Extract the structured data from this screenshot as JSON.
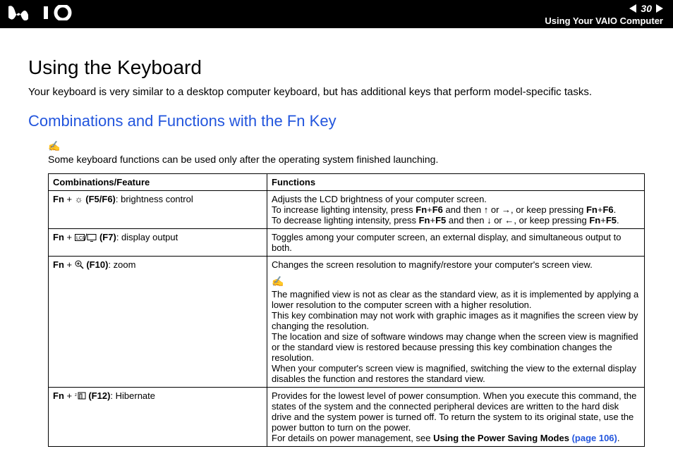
{
  "header": {
    "logo_text": "VAIO",
    "page_number": "30",
    "section": "Using Your VAIO Computer"
  },
  "title": "Using the Keyboard",
  "intro": "Your keyboard is very similar to a desktop computer keyboard, but has additional keys that perform model-specific tasks.",
  "subheading": "Combinations and Functions with the Fn Key",
  "note_top": "Some keyboard functions can be used only after the operating system finished launching.",
  "table": {
    "headers": {
      "col1": "Combinations/Feature",
      "col2": "Functions"
    },
    "row1": {
      "prefix": "Fn",
      "plus": " + ",
      "key": "(F5/F6)",
      "label": ": brightness control",
      "line1": "Adjusts the LCD brightness of your computer screen.",
      "line2a": "To increase lighting intensity, press ",
      "b_fn_f6": "Fn",
      "plus2": "+",
      "b_f6": "F6",
      "mid2": " and then ",
      "or2": " or ",
      "tail2": ", or keep pressing ",
      "b_fn_f6_2": "Fn",
      "plus2b": "+",
      "b_f6_2": "F6",
      "end2": ".",
      "line3a": "To decrease lighting intensity, press ",
      "b_fn_f5": "Fn",
      "plus3": "+",
      "b_f5": "F5",
      "mid3": " and then ",
      "or3": " or ",
      "tail3": ", or keep pressing ",
      "b_fn_f5_2": "Fn",
      "plus3b": "+",
      "b_f5_2": "F5",
      "end3": "."
    },
    "row2": {
      "prefix": "Fn",
      "plus": " + ",
      "key": "(F7)",
      "label": ": display output",
      "desc": "Toggles among your computer screen, an external display, and simultaneous output to both."
    },
    "row3": {
      "prefix": "Fn",
      "plus": " + ",
      "key": "(F10)",
      "label": ": zoom",
      "line1": "Changes the screen resolution to magnify/restore your computer's screen view.",
      "note1": "The magnified view is not as clear as the standard view, as it is implemented by applying a lower resolution to the computer screen with a higher resolution.",
      "note2": "This key combination may not work with graphic images as it magnifies the screen view by changing the resolution.",
      "note3": "The location and size of software windows may change when the screen view is magnified or the standard view is restored because pressing this key combination changes the resolution.",
      "note4": "When your computer's screen view is magnified, switching the view to the external display disables the function and restores the standard view."
    },
    "row4": {
      "prefix": "Fn",
      "plus": " + ",
      "key": "(F12)",
      "label": ": Hibernate",
      "line1": "Provides for the lowest level of power consumption. When you execute this command, the states of the system and the connected peripheral devices are written to the hard disk drive and the system power is turned off. To return the system to its original state, use the power button to turn on the power.",
      "line2a": "For details on power management, see ",
      "link_bold": "Using the Power Saving Modes ",
      "link_text": "(page 106)",
      "line2b": "."
    }
  }
}
